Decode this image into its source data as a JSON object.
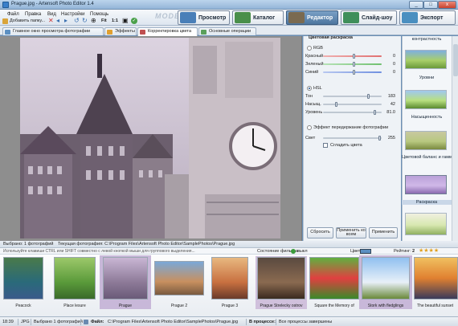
{
  "window": {
    "title": "Prague.jpg - Artensoft Photo Editor 1.4",
    "minimize": "_",
    "maximize": "□",
    "close": "x"
  },
  "menu": {
    "items": [
      "Файл",
      "Правка",
      "Вид",
      "Настройки",
      "Помощь"
    ]
  },
  "quickbar": {
    "add_folder": "Добавить папку...",
    "zoom_fit": "Fit",
    "zoom_1_1": "1:1"
  },
  "mode": {
    "label": "MODE:",
    "buttons": [
      {
        "label": "Просмотр",
        "color": "#4a7fb8"
      },
      {
        "label": "Каталог",
        "color": "#4a8f4a"
      },
      {
        "label": "Редактор",
        "color": "#7a6a50"
      },
      {
        "label": "Слайд-шоу",
        "color": "#3f8f5a"
      },
      {
        "label": "Экспорт",
        "color": "#4a8fc0"
      }
    ]
  },
  "tabs": [
    {
      "label": "Главное окно просмотра фотографии",
      "icon_color": "#5b8fc2"
    },
    {
      "label": "Эффекты",
      "icon_color": "#e0a030"
    },
    {
      "label": "Корректировка цвета",
      "icon_color": "#c05050"
    },
    {
      "label": "Основные операции",
      "icon_color": "#5ba05b"
    }
  ],
  "color_panel": {
    "group_title": "Цветовая раскраска",
    "rgb_label": "RGB",
    "rgb_sliders": [
      {
        "label": "Красный",
        "value": "0",
        "color": "#e07070"
      },
      {
        "label": "Зеленый",
        "value": "0",
        "color": "#70c070"
      },
      {
        "label": "Синий",
        "value": "0",
        "color": "#7090e0"
      }
    ],
    "hsl_label": "HSL",
    "hsl_sliders": [
      {
        "label": "Тон",
        "value": "183"
      },
      {
        "label": "Насыщ.",
        "value": "42"
      },
      {
        "label": "Уровень",
        "value": "81.0"
      }
    ],
    "overlay_label": "Эффект передержание фотографии",
    "light_label": "Свет",
    "light_value": "255",
    "smooth_label": "Сгладить цвета",
    "buttons": {
      "reset": "Сбросить",
      "apply_all": "Применить ко всем",
      "apply": "Применить"
    }
  },
  "presets": [
    {
      "label": "контрастность"
    },
    {
      "label": "Уровни"
    },
    {
      "label": "Насыщенность"
    },
    {
      "label": "Цветовой баланс и гамма"
    },
    {
      "label": "Раскраска"
    }
  ],
  "browser": {
    "selected_text": "Выбрано: 1 фотографий",
    "current_folder": "Текущая фотография: C:\\Program Files\\Artensoft Photo Editor\\SamplePhotos\\Prague.jpg",
    "hint": "Используйте клавиши CTRL или SHIFT совместно с левой кнопкой мыши для группового выделения...",
    "filter_label": "Состояние фильтра:",
    "filter_value": "выкл",
    "color_label": "Цвет:",
    "rating_label": "Рейтинг:",
    "rating_value": "2",
    "thumbs": [
      {
        "label": "Peacock"
      },
      {
        "label": "Place lesure"
      },
      {
        "label": "Prague"
      },
      {
        "label": "Prague 2"
      },
      {
        "label": "Prague 3"
      },
      {
        "label": "Prague Strelecky ostrov"
      },
      {
        "label": "Square the Memory of"
      },
      {
        "label": "Stork with fledglings"
      },
      {
        "label": "The beautiful sunset"
      }
    ]
  },
  "status": {
    "time": "18:39",
    "format": "JPG",
    "selected": "Выбрано 1 фотографий",
    "file_label": "Файл:",
    "file_path": "C:\\Program Files\\Artensoft Photo Editor\\SamplePhotos\\Prague.jpg",
    "progress_label": "В процессе:",
    "progress_text": "Все процессы завершены"
  }
}
